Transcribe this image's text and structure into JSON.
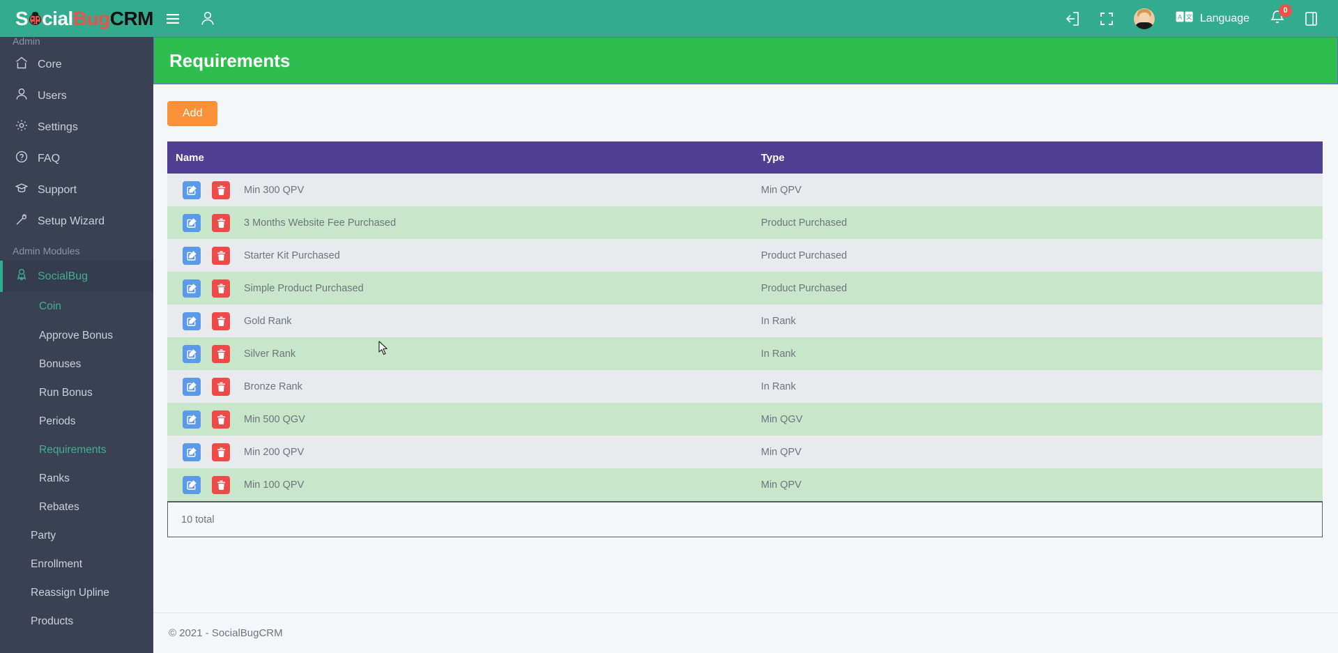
{
  "topbar": {
    "brand": {
      "part1": "S",
      "bug_icon": "ladybug-icon",
      "part2": "cial",
      "part3": "Bug",
      "part4": "CRM"
    },
    "menu_toggle_icon": "hamburger-menu-icon",
    "user_icon": "user-outline-icon",
    "logout_icon": "logout-icon",
    "fullscreen_icon": "fullscreen-icon",
    "avatar_icon": "avatar",
    "language_icon": "translate-icon",
    "language_label": "Language",
    "notifications_icon": "bell-icon",
    "notifications_count": "0",
    "panel_icon": "book-panel-icon",
    "bg_color": "#33ab8f"
  },
  "sidebar": {
    "section_admin": "Admin",
    "items": [
      {
        "label": "Core",
        "icon": "home-icon"
      },
      {
        "label": "Users",
        "icon": "user-icon"
      },
      {
        "label": "Settings",
        "icon": "gear-icon"
      },
      {
        "label": "FAQ",
        "icon": "question-circle-icon"
      },
      {
        "label": "Support",
        "icon": "graduation-cap-icon"
      },
      {
        "label": "Setup Wizard",
        "icon": "magic-wand-icon"
      }
    ],
    "section_modules": "Admin Modules",
    "module": {
      "label": "SocialBug",
      "icon": "award-person-icon"
    },
    "sub_items": [
      {
        "label": "Coin",
        "level": "head",
        "active": true
      },
      {
        "label": "Approve Bonus",
        "level": "2",
        "active": false
      },
      {
        "label": "Bonuses",
        "level": "2",
        "active": false
      },
      {
        "label": "Run Bonus",
        "level": "2",
        "active": false
      },
      {
        "label": "Periods",
        "level": "2",
        "active": false
      },
      {
        "label": "Requirements",
        "level": "2",
        "active": true
      },
      {
        "label": "Ranks",
        "level": "2",
        "active": false
      },
      {
        "label": "Rebates",
        "level": "2",
        "active": false
      },
      {
        "label": "Party",
        "level": "1",
        "active": false
      },
      {
        "label": "Enrollment",
        "level": "1",
        "active": false
      },
      {
        "label": "Reassign Upline",
        "level": "1",
        "active": false
      },
      {
        "label": "Products",
        "level": "1",
        "active": false
      }
    ],
    "accent_color": "#33ab8f",
    "bg_color": "#3b4155"
  },
  "page": {
    "title": "Requirements",
    "header_bg": "#2ebd4e",
    "add_button": "Add",
    "add_button_color": "#fa9037"
  },
  "table": {
    "header_bg": "#4e3f93",
    "columns": [
      "Name",
      "Type"
    ],
    "edit_icon": "edit-pencil-icon",
    "delete_icon": "trash-icon",
    "rows": [
      {
        "name": "Min 300 QPV",
        "type": "Min QPV"
      },
      {
        "name": "3 Months Website Fee Purchased",
        "type": "Product Purchased"
      },
      {
        "name": "Starter Kit Purchased",
        "type": "Product Purchased"
      },
      {
        "name": "Simple Product Purchased",
        "type": "Product Purchased"
      },
      {
        "name": "Gold Rank",
        "type": "In Rank"
      },
      {
        "name": "Silver Rank",
        "type": "In Rank"
      },
      {
        "name": "Bronze Rank",
        "type": "In Rank"
      },
      {
        "name": "Min 500 QGV",
        "type": "Min QGV"
      },
      {
        "name": "Min 200 QPV",
        "type": "Min QPV"
      },
      {
        "name": "Min 100 QPV",
        "type": "Min QPV"
      }
    ],
    "total_label": "10 total"
  },
  "footer": {
    "copyright": "© 2021 - SocialBugCRM"
  }
}
